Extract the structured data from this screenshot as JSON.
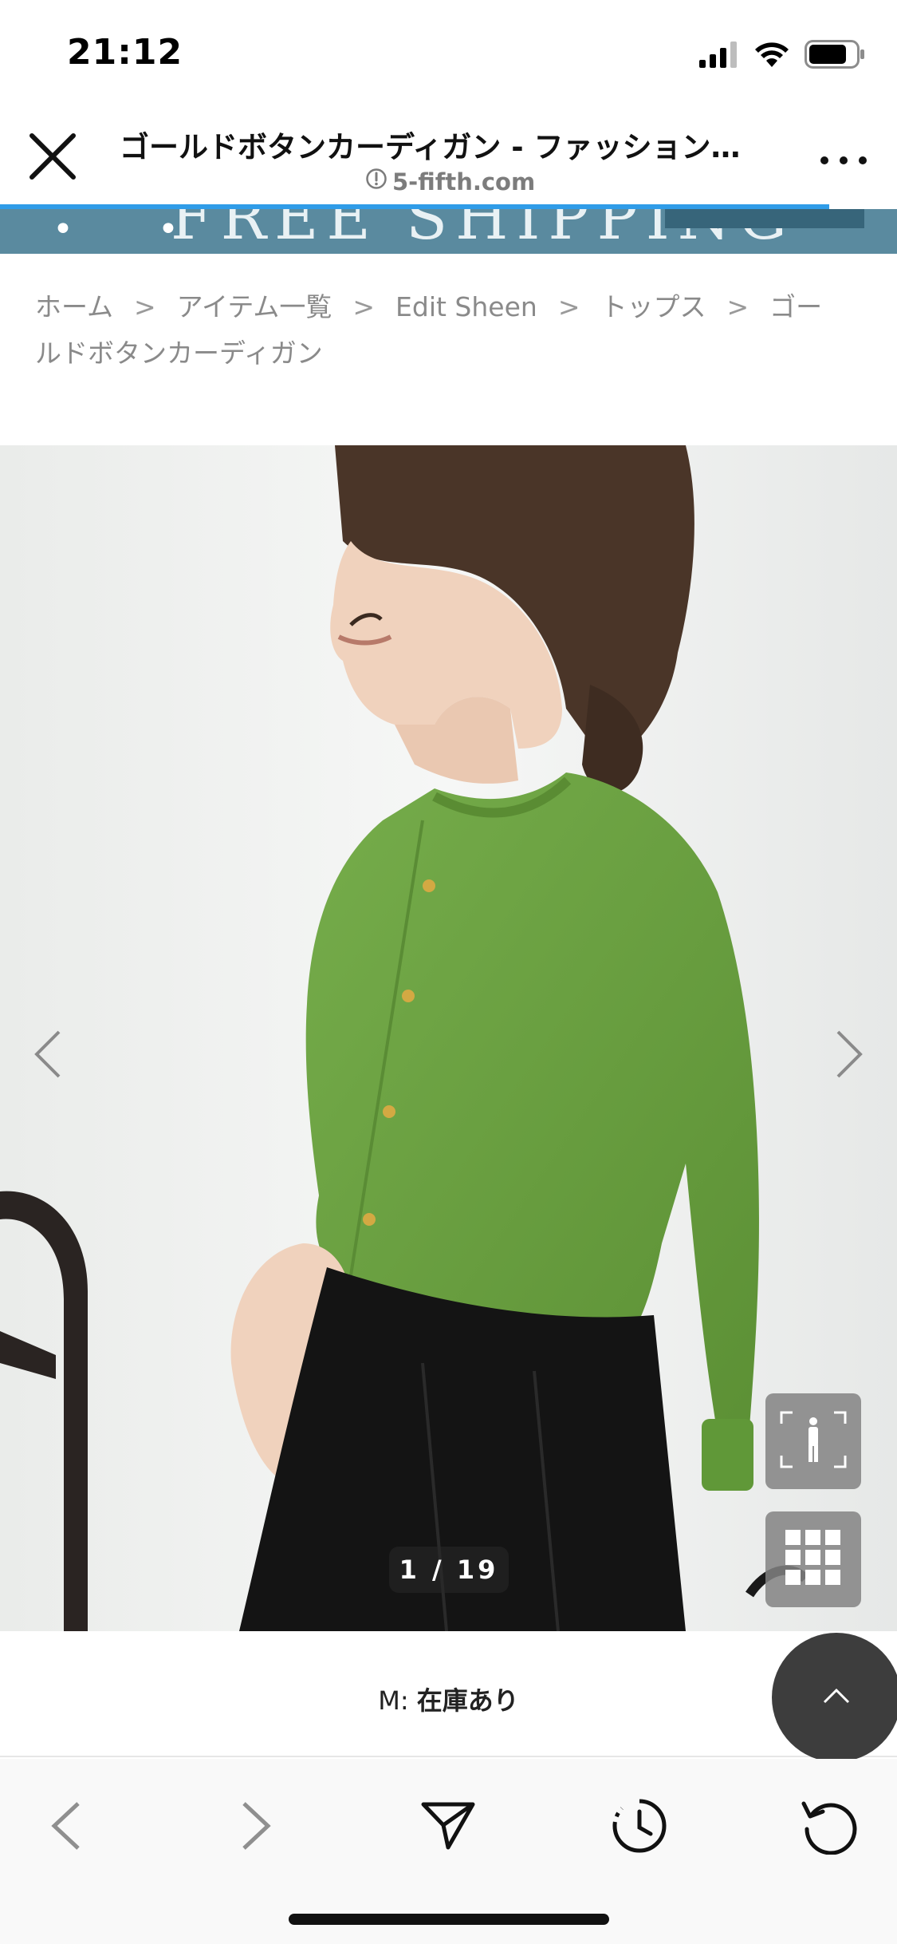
{
  "status_bar": {
    "time": "21:12",
    "icons": [
      "cellular-signal-icon",
      "wifi-icon",
      "battery-icon"
    ]
  },
  "browser": {
    "page_title": "ゴールドボタンカーディガン - ファッション…",
    "domain": "5-fifth.com",
    "close_icon": "close-icon",
    "more_icon": "more-icon"
  },
  "promo": {
    "text": "FREE SHIPPING",
    "dots": "• •"
  },
  "breadcrumb": {
    "items": [
      "ホーム",
      "アイテム一覧",
      "Edit Sheen",
      "トップス",
      "ゴールドボタンカーディガン"
    ],
    "separator": ">"
  },
  "gallery": {
    "counter": "1 / 19",
    "current": 1,
    "total": 19
  },
  "stock": {
    "size": "M:",
    "status": "在庫あり"
  },
  "toolbar": {
    "items": [
      "back-icon",
      "forward-icon",
      "share-icon",
      "history-icon",
      "reload-icon"
    ]
  },
  "colors": {
    "accent": "#2f9ce8",
    "banner": "#5a8a9f",
    "cardigan": "#6aa040"
  }
}
